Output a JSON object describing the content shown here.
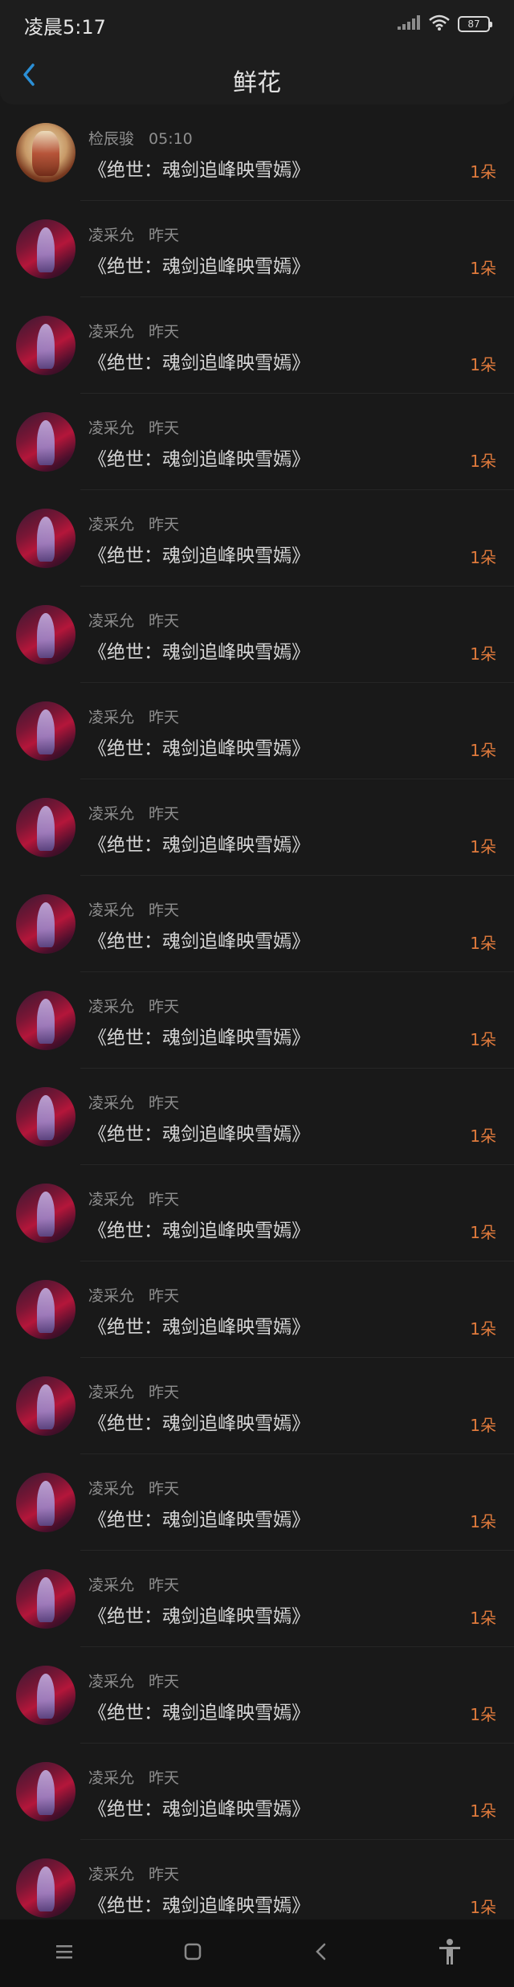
{
  "status_bar": {
    "time": "凌晨5:17",
    "battery": "87"
  },
  "header": {
    "title": "鲜花"
  },
  "rows": [
    {
      "avatar": "sun",
      "name": "检辰骏",
      "time": "05:10",
      "title": "《绝世：魂剑追峰映雪嫣》",
      "count": "1朵"
    },
    {
      "avatar": "moon",
      "name": "凌采允",
      "time": "昨天",
      "title": "《绝世：魂剑追峰映雪嫣》",
      "count": "1朵"
    },
    {
      "avatar": "moon",
      "name": "凌采允",
      "time": "昨天",
      "title": "《绝世：魂剑追峰映雪嫣》",
      "count": "1朵"
    },
    {
      "avatar": "moon",
      "name": "凌采允",
      "time": "昨天",
      "title": "《绝世：魂剑追峰映雪嫣》",
      "count": "1朵"
    },
    {
      "avatar": "moon",
      "name": "凌采允",
      "time": "昨天",
      "title": "《绝世：魂剑追峰映雪嫣》",
      "count": "1朵"
    },
    {
      "avatar": "moon",
      "name": "凌采允",
      "time": "昨天",
      "title": "《绝世：魂剑追峰映雪嫣》",
      "count": "1朵"
    },
    {
      "avatar": "moon",
      "name": "凌采允",
      "time": "昨天",
      "title": "《绝世：魂剑追峰映雪嫣》",
      "count": "1朵"
    },
    {
      "avatar": "moon",
      "name": "凌采允",
      "time": "昨天",
      "title": "《绝世：魂剑追峰映雪嫣》",
      "count": "1朵"
    },
    {
      "avatar": "moon",
      "name": "凌采允",
      "time": "昨天",
      "title": "《绝世：魂剑追峰映雪嫣》",
      "count": "1朵"
    },
    {
      "avatar": "moon",
      "name": "凌采允",
      "time": "昨天",
      "title": "《绝世：魂剑追峰映雪嫣》",
      "count": "1朵"
    },
    {
      "avatar": "moon",
      "name": "凌采允",
      "time": "昨天",
      "title": "《绝世：魂剑追峰映雪嫣》",
      "count": "1朵"
    },
    {
      "avatar": "moon",
      "name": "凌采允",
      "time": "昨天",
      "title": "《绝世：魂剑追峰映雪嫣》",
      "count": "1朵"
    },
    {
      "avatar": "moon",
      "name": "凌采允",
      "time": "昨天",
      "title": "《绝世：魂剑追峰映雪嫣》",
      "count": "1朵"
    },
    {
      "avatar": "moon",
      "name": "凌采允",
      "time": "昨天",
      "title": "《绝世：魂剑追峰映雪嫣》",
      "count": "1朵"
    },
    {
      "avatar": "moon",
      "name": "凌采允",
      "time": "昨天",
      "title": "《绝世：魂剑追峰映雪嫣》",
      "count": "1朵"
    },
    {
      "avatar": "moon",
      "name": "凌采允",
      "time": "昨天",
      "title": "《绝世：魂剑追峰映雪嫣》",
      "count": "1朵"
    },
    {
      "avatar": "moon",
      "name": "凌采允",
      "time": "昨天",
      "title": "《绝世：魂剑追峰映雪嫣》",
      "count": "1朵"
    },
    {
      "avatar": "moon",
      "name": "凌采允",
      "time": "昨天",
      "title": "《绝世：魂剑追峰映雪嫣》",
      "count": "1朵"
    },
    {
      "avatar": "moon",
      "name": "凌采允",
      "time": "昨天",
      "title": "《绝世：魂剑追峰映雪嫣》",
      "count": "1朵"
    }
  ],
  "icons": {
    "back": "chevron-left-icon",
    "signal": "signal-icon",
    "wifi": "wifi-icon",
    "battery": "battery-icon",
    "menu": "menu-icon",
    "home": "home-icon",
    "back_nav": "back-nav-icon",
    "accessibility": "accessibility-icon"
  },
  "colors": {
    "accent_back": "#2b8fd6",
    "count": "#e07a3c",
    "background": "#191919"
  }
}
